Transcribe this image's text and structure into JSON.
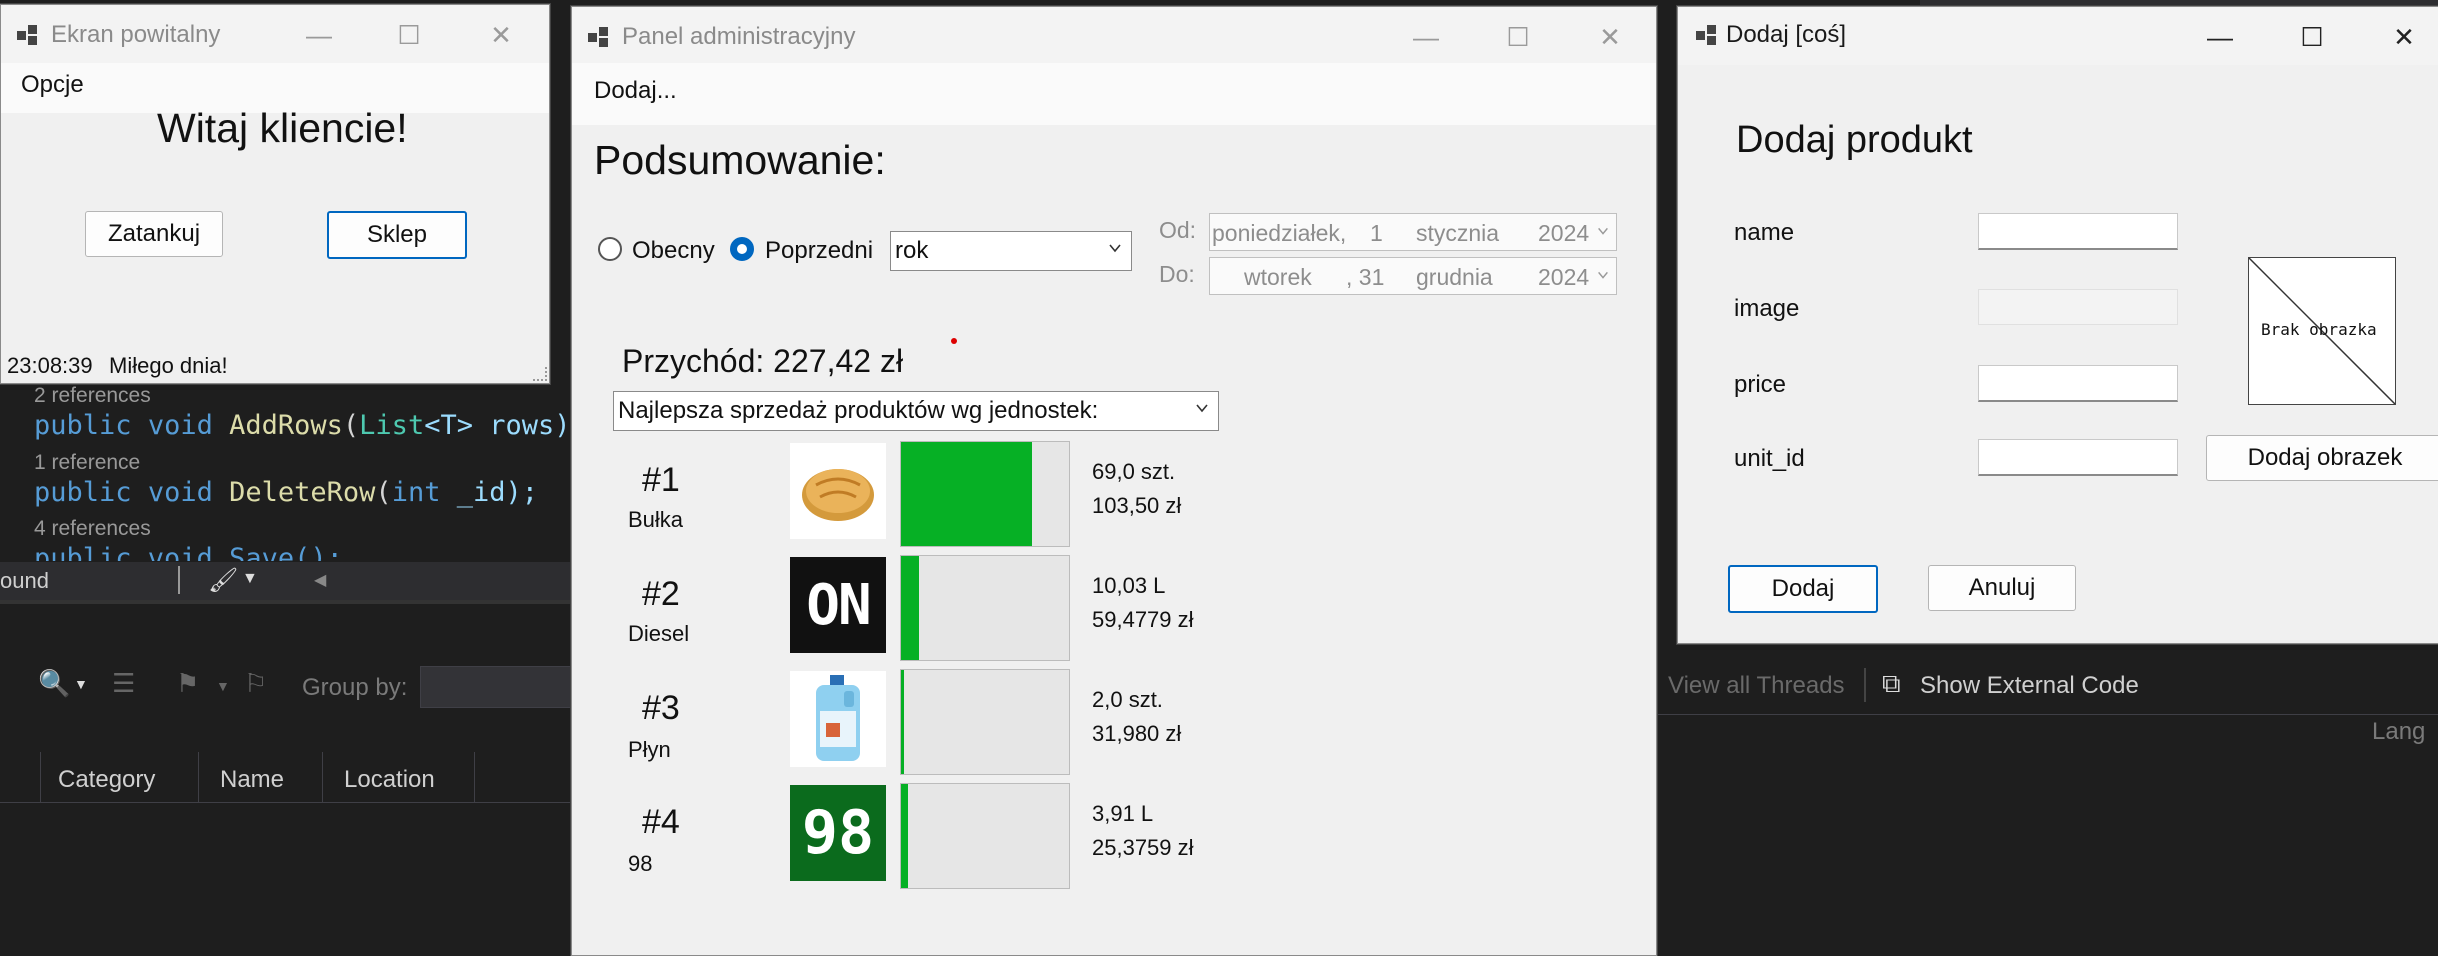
{
  "ide": {
    "ref1": "2 references",
    "code1_kw": "public",
    "code1_kw2": "void",
    "code1_fn": "AddRows",
    "code1_ty": "List",
    "code1_rest": "<T> rows);",
    "ref2": "1 reference",
    "code2_fn": "DeleteRow",
    "code2_ty": "int",
    "code2_rest": "_id);",
    "ref3": "4 references",
    "code3": "public void Save();",
    "toolbar_left": "ound",
    "group_by": "Group by:",
    "columns": [
      "Category",
      "Name",
      "Location"
    ],
    "view_threads": "View all Threads",
    "show_external": "Show External Code",
    "lang": "Lang"
  },
  "splash": {
    "title": "Ekran powitalny",
    "menu": "Opcje",
    "heading": "Witaj kliencie!",
    "btn_refuel": "Zatankuj",
    "btn_shop": "Sklep",
    "status_time": "23:08:39",
    "status_msg": "Miłego dnia!"
  },
  "admin": {
    "title": "Panel administracyjny",
    "menu": "Dodaj...",
    "heading": "Podsumowanie:",
    "radio_current": "Obecny",
    "radio_previous": "Poprzedni",
    "period": "rok",
    "from_label": "Od:",
    "to_label": "Do:",
    "from_date": {
      "day": "poniedziałek,",
      "num": "1",
      "month": "stycznia",
      "year": "2024"
    },
    "to_date": {
      "day": "wtorek",
      "num": ", 31",
      "month": "grudnia",
      "year": "2024"
    },
    "income": "Przychód: 227,42 zł",
    "sort_select": "Najlepsza sprzedaż produktów wg jednostek:",
    "progress_color": "#06b025",
    "ranks": [
      {
        "rank": "#1",
        "name": "Bułka",
        "qty": "69,0 szt.",
        "value": "103,50 zł",
        "fill": 0.78,
        "thumb": "bread"
      },
      {
        "rank": "#2",
        "name": "Diesel",
        "qty": "10,03 L",
        "value": "59,4779 zł",
        "fill": 0.11,
        "thumb": "ON"
      },
      {
        "rank": "#3",
        "name": "Płyn",
        "qty": "2,0 szt.",
        "value": "31,980 zł",
        "fill": 0.02,
        "thumb": "bottle"
      },
      {
        "rank": "#4",
        "name": "98",
        "qty": "3,91 L",
        "value": "25,3759 zł",
        "fill": 0.04,
        "thumb": "98"
      }
    ]
  },
  "add": {
    "title": "Dodaj [coś]",
    "heading": "Dodaj produkt",
    "fields": [
      "name",
      "image",
      "price",
      "unit_id"
    ],
    "no_image": "Brak obrazka",
    "btn_add_image": "Dodaj obrazek",
    "btn_add": "Dodaj",
    "btn_cancel": "Anuluj"
  }
}
